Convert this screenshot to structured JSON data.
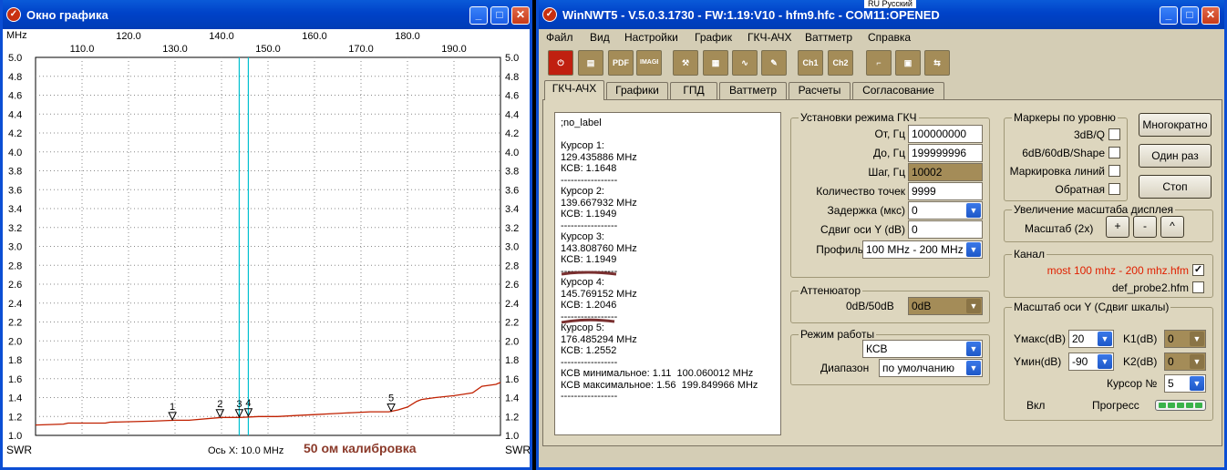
{
  "graph_window": {
    "title": "Окно графика",
    "x_unit": "MHz",
    "y_unit": "SWR",
    "axis_note": "Ось X: 10.0 MHz",
    "caption": "50 ом калибровка",
    "caption_color": "#8b3a2a",
    "trace_color": "#c02000",
    "cursor_color": "#00c0d0"
  },
  "chart_data": {
    "type": "line",
    "xlabel": "MHz",
    "ylabel": "SWR",
    "xlim": [
      100,
      200
    ],
    "ylim": [
      1.0,
      5.0
    ],
    "y_ticks": [
      "5.0",
      "4.8",
      "4.6",
      "4.4",
      "4.2",
      "4.0",
      "3.8",
      "3.6",
      "3.4",
      "3.2",
      "3.0",
      "2.8",
      "2.6",
      "2.4",
      "2.2",
      "2.0",
      "1.8",
      "1.6",
      "1.4",
      "1.2",
      "1.0"
    ],
    "x_ticks_upper": [
      "120.0",
      "140.0",
      "160.0",
      "180.0"
    ],
    "x_ticks_lower": [
      "110.0",
      "130.0",
      "150.0",
      "170.0",
      "190.0"
    ],
    "series": [
      {
        "x": [
          100,
          106,
          107,
          115,
          116,
          125,
          130,
          133,
          140,
          144,
          148,
          152,
          156,
          160,
          164,
          168,
          172,
          176,
          178,
          180,
          182,
          183,
          186,
          190,
          194,
          196,
          199,
          200
        ],
        "y": [
          1.11,
          1.12,
          1.13,
          1.13,
          1.14,
          1.15,
          1.16,
          1.16,
          1.19,
          1.19,
          1.2,
          1.2,
          1.21,
          1.22,
          1.23,
          1.24,
          1.25,
          1.25,
          1.27,
          1.3,
          1.36,
          1.38,
          1.4,
          1.42,
          1.45,
          1.52,
          1.54,
          1.56
        ]
      }
    ],
    "cursors": [
      {
        "label": "1",
        "x": 129.435886,
        "y": 1.1648
      },
      {
        "label": "2",
        "x": 139.667932,
        "y": 1.1949
      },
      {
        "label": "3",
        "x": 143.80876,
        "y": 1.1949
      },
      {
        "label": "4",
        "x": 145.769152,
        "y": 1.2046
      },
      {
        "label": "5",
        "x": 176.485294,
        "y": 1.2552
      }
    ],
    "vertical_lines_x": [
      143.80876,
      145.769152
    ]
  },
  "main_window": {
    "title": "WinNWT5 - V.5.0.3.1730 - FW:1.19:V10 - hfm9.hfc - COM11:OPENED",
    "lang_indicator": "RU Русский",
    "menu": [
      "Файл",
      "Вид",
      "Настройки",
      "График",
      "ГКЧ-АЧХ",
      "Ваттметр",
      "Справка"
    ],
    "toolbar": [
      "power-icon",
      "printer-icon",
      "pdf-icon",
      "image-icon",
      "tools-icon",
      "grid-icon",
      "wave-icon",
      "probe-icon",
      "ch1-icon",
      "ch2-icon",
      "step-icon",
      "save-icon",
      "swap-icon"
    ],
    "toolbar_labels": {
      "pdf": "PDF",
      "image": "IMAGE",
      "ch1": "Ch1",
      "ch2": "Ch2"
    },
    "tabs": [
      "ГКЧ-АЧХ",
      "Графики",
      "ГПД",
      "Ваттметр",
      "Расчеты",
      "Согласование"
    ],
    "active_tab": "ГКЧ-АЧХ",
    "textbox": ";no_label\n\nКурсор 1:\n129.435886 MHz\nКСВ: 1.1648\n-----------------\nКурсор 2:\n139.667932 MHz\nКСВ: 1.1949\n-----------------\nКурсор 3:\n143.808760 MHz\nКСВ: 1.1949\n-----------------\nКурсор 4:\n145.769152 MHz\nКСВ: 1.2046\n-----------------\nКурсор 5:\n176.485294 MHz\nКСВ: 1.2552\n-----------------\nКСВ минимальное: 1.11  100.060012 MHz\nКСВ максимальное: 1.56  199.849966 MHz\n-----------------",
    "sweep": {
      "legend": "Установки режима ГКЧ",
      "from_label": "От, Гц",
      "from_value": "100000000",
      "to_label": "До, Гц",
      "to_value": "199999996",
      "step_label": "Шаг, Гц",
      "step_value": "10002",
      "points_label": "Количество точек",
      "points_value": "9999",
      "delay_label": "Задержка (мкс)",
      "delay_value": "0",
      "yshift_label": "Сдвиг оси Y (dB)",
      "yshift_value": "0",
      "profile_label": "Профиль",
      "profile_value": "100 MHz - 200 MHz"
    },
    "attenuator": {
      "legend": "Аттенюатор",
      "label": "0dB/50dB",
      "value": "0dB"
    },
    "mode": {
      "legend": "Режим работы",
      "value": "КСВ",
      "range_label": "Диапазон",
      "range_value": "по умолчанию"
    },
    "markers": {
      "legend": "Маркеры по уровню",
      "items": [
        "3dB/Q",
        "6dB/60dB/Shape",
        "Маркировка линий",
        "Обратная"
      ]
    },
    "zoom": {
      "legend": "Увеличение масштаба дисплея",
      "label": "Масштаб (2x)",
      "buttons": [
        "+",
        "-",
        "^"
      ]
    },
    "channel": {
      "legend": "Канал",
      "item1": "most 100 mhz - 200 mhz.hfm",
      "item1_color": "#e02000",
      "item2": "def_probe2.hfm"
    },
    "yscale": {
      "legend": "Масштаб оси Y (Сдвиг шкалы)",
      "ymax_label": "Yмакс(dB)",
      "ymax_value": "20",
      "ymin_label": "Yмин(dB)",
      "ymin_value": "-90",
      "k1_label": "K1(dB)",
      "k1_value": "0",
      "k2_label": "K2(dB)",
      "k2_value": "0",
      "cursor_label": "Курсор №",
      "cursor_value": "5",
      "on_label": "Вкл",
      "progress_label": "Прогресс"
    },
    "buttons": {
      "multi": "Многократно",
      "once": "Один раз",
      "stop": "Стоп"
    }
  }
}
